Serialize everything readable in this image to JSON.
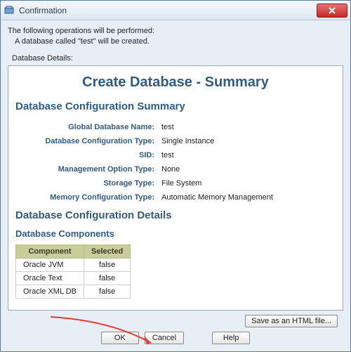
{
  "window": {
    "title": "Confirmation"
  },
  "intro": {
    "line1": "The following operations will be performed:",
    "line2": "A database called \"test\" will be created.",
    "detailsLabel": "Database Details:"
  },
  "summary": {
    "pageTitle": "Create Database - Summary",
    "configHeading": "Database Configuration Summary",
    "fields": {
      "globalDbName": {
        "label": "Global Database Name:",
        "value": "test"
      },
      "configType": {
        "label": "Database Configuration Type:",
        "value": "Single Instance"
      },
      "sid": {
        "label": "SID:",
        "value": "test"
      },
      "mgmtOption": {
        "label": "Management Option Type:",
        "value": "None"
      },
      "storageType": {
        "label": "Storage Type:",
        "value": "File System"
      },
      "memoryConfig": {
        "label": "Memory Configuration Type:",
        "value": "Automatic Memory Management"
      }
    },
    "detailsHeading": "Database Configuration Details",
    "componentsHeading": "Database Components",
    "componentsTable": {
      "headers": {
        "component": "Component",
        "selected": "Selected"
      },
      "rows": [
        {
          "name": "Oracle JVM",
          "selected": "false"
        },
        {
          "name": "Oracle Text",
          "selected": "false"
        },
        {
          "name": "Oracle XML DB",
          "selected": "false"
        }
      ]
    }
  },
  "buttons": {
    "saveHtml": "Save as an HTML file...",
    "ok": "OK",
    "cancel": "Cancel",
    "help": "Help"
  }
}
